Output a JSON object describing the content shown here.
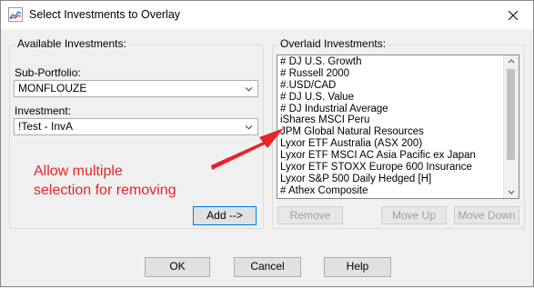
{
  "window": {
    "title": "Select Investments to Overlay",
    "icon": "chart-icon",
    "close_icon": "close-icon"
  },
  "available": {
    "group_label": "Available Investments:",
    "sub_portfolio_label": "Sub-Portfolio:",
    "sub_portfolio_value": "MONFLOUZE",
    "investment_label": "Investment:",
    "investment_value": "!Test - InvA",
    "add_button": "Add -->"
  },
  "overlaid": {
    "group_label": "Overlaid Investments:",
    "items": [
      "# DJ U.S. Growth",
      "# Russell 2000",
      "#.USD/CAD",
      "# DJ U.S. Value",
      "# DJ Industrial Average",
      "iShares MSCI Peru",
      "JPM Global Natural Resources",
      "Lyxor ETF Australia (ASX 200)",
      "Lyxor ETF MSCI AC Asia Pacific ex Japan",
      "Lyxor ETF STOXX Europe 600 Insurance",
      "Lyxor S&P 500 Daily Hedged [H]",
      "# Athex Composite"
    ],
    "remove_button": "Remove",
    "move_up_button": "Move Up",
    "move_down_button": "Move Down"
  },
  "footer": {
    "ok": "OK",
    "cancel": "Cancel",
    "help": "Help"
  },
  "annotation": {
    "line1": "Allow multiple",
    "line2": "selection for removing",
    "color": "#e8232a"
  }
}
